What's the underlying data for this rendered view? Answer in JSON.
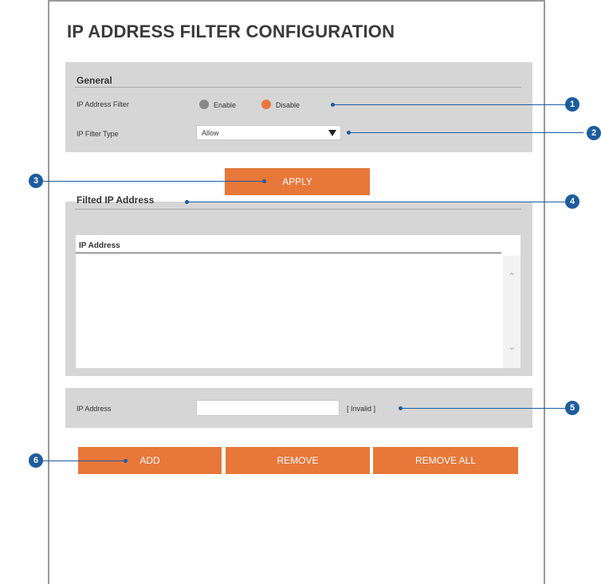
{
  "page": {
    "title": "IP ADDRESS FILTER CONFIGURATION"
  },
  "general": {
    "title": "General",
    "filter_label": "IP Address Filter",
    "enable_label": "Enable",
    "disable_label": "Disable",
    "selected": "Disable",
    "type_label": "IP Filter Type",
    "type_value": "Allow"
  },
  "apply_label": "APPLY",
  "filtered": {
    "title": "Filted IP Address",
    "column": "IP Address",
    "rows": []
  },
  "entry": {
    "label": "IP Address",
    "value": "",
    "status": "[ Invalid ]"
  },
  "actions": {
    "add": "ADD",
    "remove": "REMOVE",
    "remove_all": "REMOVE ALL"
  },
  "callouts": [
    "1",
    "2",
    "3",
    "4",
    "5",
    "6"
  ],
  "colors": {
    "accent": "#e8773a",
    "callout": "#1d5c9e",
    "section_bg": "#d6d6d6"
  }
}
